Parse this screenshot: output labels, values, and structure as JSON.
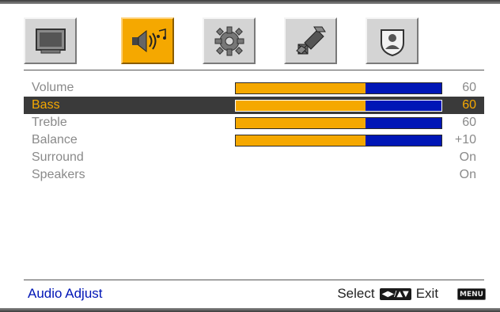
{
  "tabs": [
    {
      "name": "picture",
      "icon": "tv-icon",
      "active": false
    },
    {
      "name": "audio",
      "icon": "speaker-music-icon",
      "active": true
    },
    {
      "name": "setup",
      "icon": "gear-icon",
      "active": false
    },
    {
      "name": "satellite",
      "icon": "satellite-icon",
      "active": false
    },
    {
      "name": "parental",
      "icon": "shield-person-icon",
      "active": false
    }
  ],
  "menu": {
    "items": [
      {
        "label": "Volume",
        "value": "60",
        "level": 0.63
      },
      {
        "label": "Bass",
        "value": "60",
        "level": 0.63
      },
      {
        "label": "Treble",
        "value": "60",
        "level": 0.63
      },
      {
        "label": "Balance",
        "value": "+10",
        "level": 0.63
      },
      {
        "label": "Surround",
        "value": "On"
      },
      {
        "label": "Speakers",
        "value": "On"
      }
    ],
    "selected_index": 1
  },
  "footer": {
    "title": "Audio Adjust",
    "select_label": "Select",
    "exit_label": "Exit",
    "menu_key": "MENU"
  },
  "colors": {
    "accent": "#f5a800",
    "bar_empty": "#0016b6",
    "footer_title": "#0016b6"
  }
}
